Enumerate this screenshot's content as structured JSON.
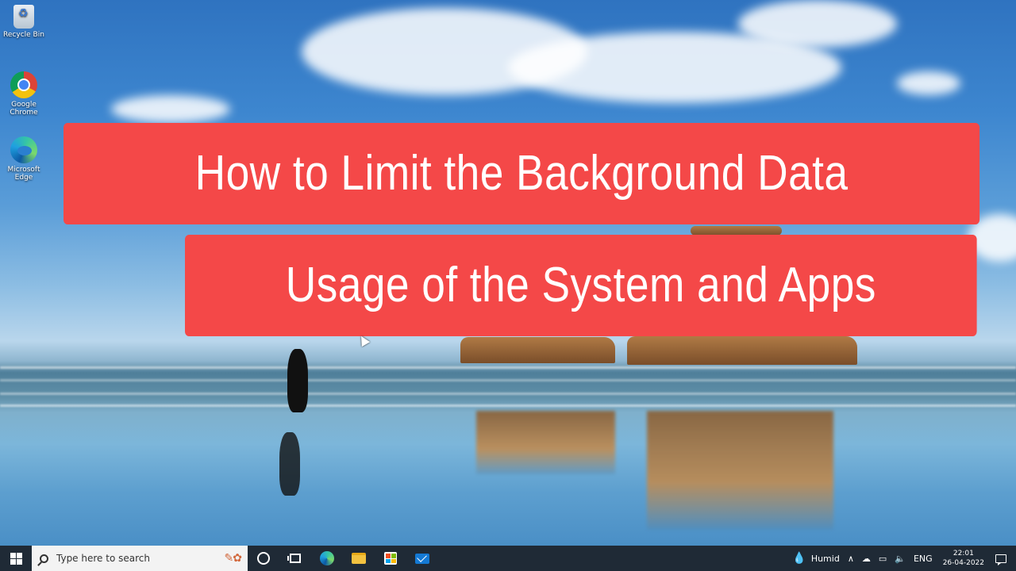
{
  "desktop": {
    "icons": [
      {
        "label": "Recycle Bin",
        "icon": "recycle-bin-icon"
      },
      {
        "label": "Google Chrome",
        "icon": "chrome-icon"
      },
      {
        "label": "Microsoft Edge",
        "icon": "edge-icon"
      }
    ]
  },
  "title": {
    "line1": "How to Limit the Background Data",
    "line2": "Usage of the System and Apps",
    "banner_color": "#f44848"
  },
  "taskbar": {
    "search_placeholder": "Type here to search",
    "pinned_apps": [
      "cortana-icon",
      "task-view-icon",
      "edge-icon",
      "file-explorer-icon",
      "store-icon",
      "mail-icon"
    ],
    "tray": {
      "weather": "Humid",
      "language": "ENG",
      "time": "22:01",
      "date": "26-04-2022"
    },
    "background": "#1f2a36"
  }
}
